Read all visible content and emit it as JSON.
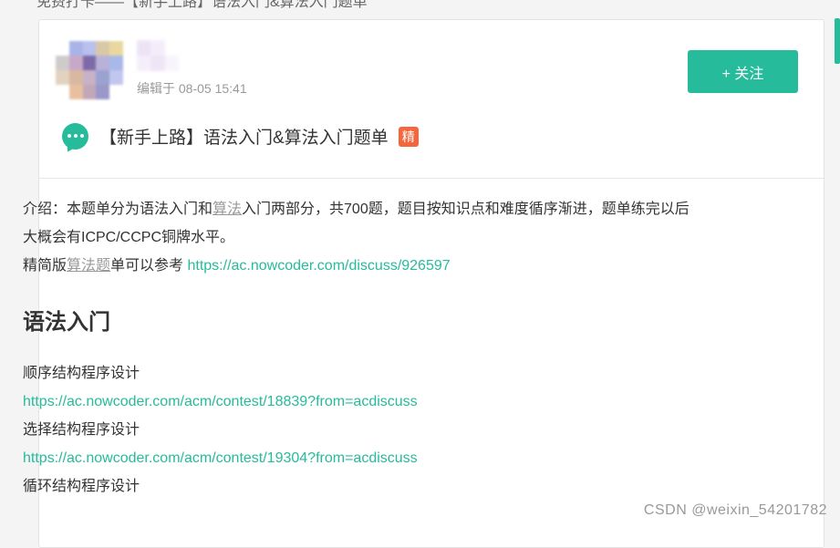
{
  "top_strip_text": "免费打卡——【新手上路】语法入门&算法入门题单",
  "post": {
    "edit_time": "编辑于 08-05 15:41",
    "follow_label": "+ 关注",
    "title": "【新手上路】语法入门&算法入门题单",
    "badge": "精"
  },
  "content": {
    "intro_1a": "介绍：本题单分为语法入门和",
    "intro_1_kw": "算法",
    "intro_1b": "入门两部分，共700题，题目按知识点和难度循序渐进，题单练完以后",
    "intro_2": "大概会有ICPC/CCPC铜牌水平。",
    "intro_3a": "精简版",
    "intro_3_kw": "算法题",
    "intro_3b": "单可以参考 ",
    "intro_3_link": "https://ac.nowcoder.com/discuss/926597",
    "section_title": "语法入门",
    "items": [
      {
        "label": "顺序结构程序设计",
        "link": "https://ac.nowcoder.com/acm/contest/18839?from=acdiscuss"
      },
      {
        "label": "选择结构程序设计",
        "link": "https://ac.nowcoder.com/acm/contest/19304?from=acdiscuss"
      },
      {
        "label": "循环结构程序设计",
        "link": ""
      }
    ]
  },
  "watermark": "CSDN @weixin_54201782",
  "colors": {
    "accent": "#25bb9b",
    "badge": "#f5663c"
  }
}
